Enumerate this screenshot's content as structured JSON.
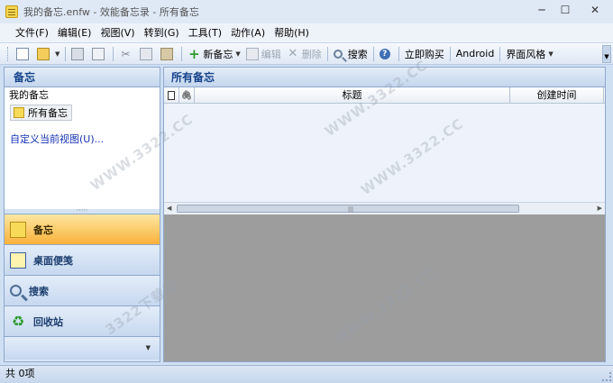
{
  "window": {
    "title": "我的备忘.enfw - 效能备忘录 - 所有备忘",
    "minimize": "─",
    "maximize": "☐",
    "close": "✕"
  },
  "menu": [
    {
      "label": "文件(F)"
    },
    {
      "label": "编辑(E)"
    },
    {
      "label": "视图(V)"
    },
    {
      "label": "转到(G)"
    },
    {
      "label": "工具(T)"
    },
    {
      "label": "动作(A)"
    },
    {
      "label": "帮助(H)"
    }
  ],
  "toolbar": {
    "new_memo": "新备忘",
    "edit": "编辑",
    "delete": "删除",
    "search": "搜索",
    "buy_now": "立即购买",
    "android": "Android",
    "ui_style": "界面风格",
    "help_glyph": "?"
  },
  "left_panel": {
    "header": "备忘",
    "tree_root": "我的备忘",
    "tree_item": "所有备忘",
    "custom_view_link": "自定义当前视图(U)...",
    "splitter_dots": "·····",
    "nav": [
      {
        "label": "备忘",
        "icon": "memo-note-icon",
        "active": true
      },
      {
        "label": "桌面便笺",
        "icon": "desktop-sticky-icon",
        "active": false
      },
      {
        "label": "搜索",
        "icon": "search-icon",
        "active": false
      },
      {
        "label": "回收站",
        "icon": "recycle-bin-icon",
        "active": false
      }
    ]
  },
  "right_panel": {
    "header": "所有备忘",
    "columns": {
      "attachment_glyph": "🖇",
      "title": "标题",
      "created_time": "创建时间"
    }
  },
  "statusbar": {
    "count_text": "共 0项"
  },
  "watermark": {
    "text": "WWW.3322.CC",
    "text2": "3322下载站"
  },
  "colors": {
    "accent_active": "#f9b13a",
    "header_text": "#15428b",
    "link": "#1432b4"
  }
}
